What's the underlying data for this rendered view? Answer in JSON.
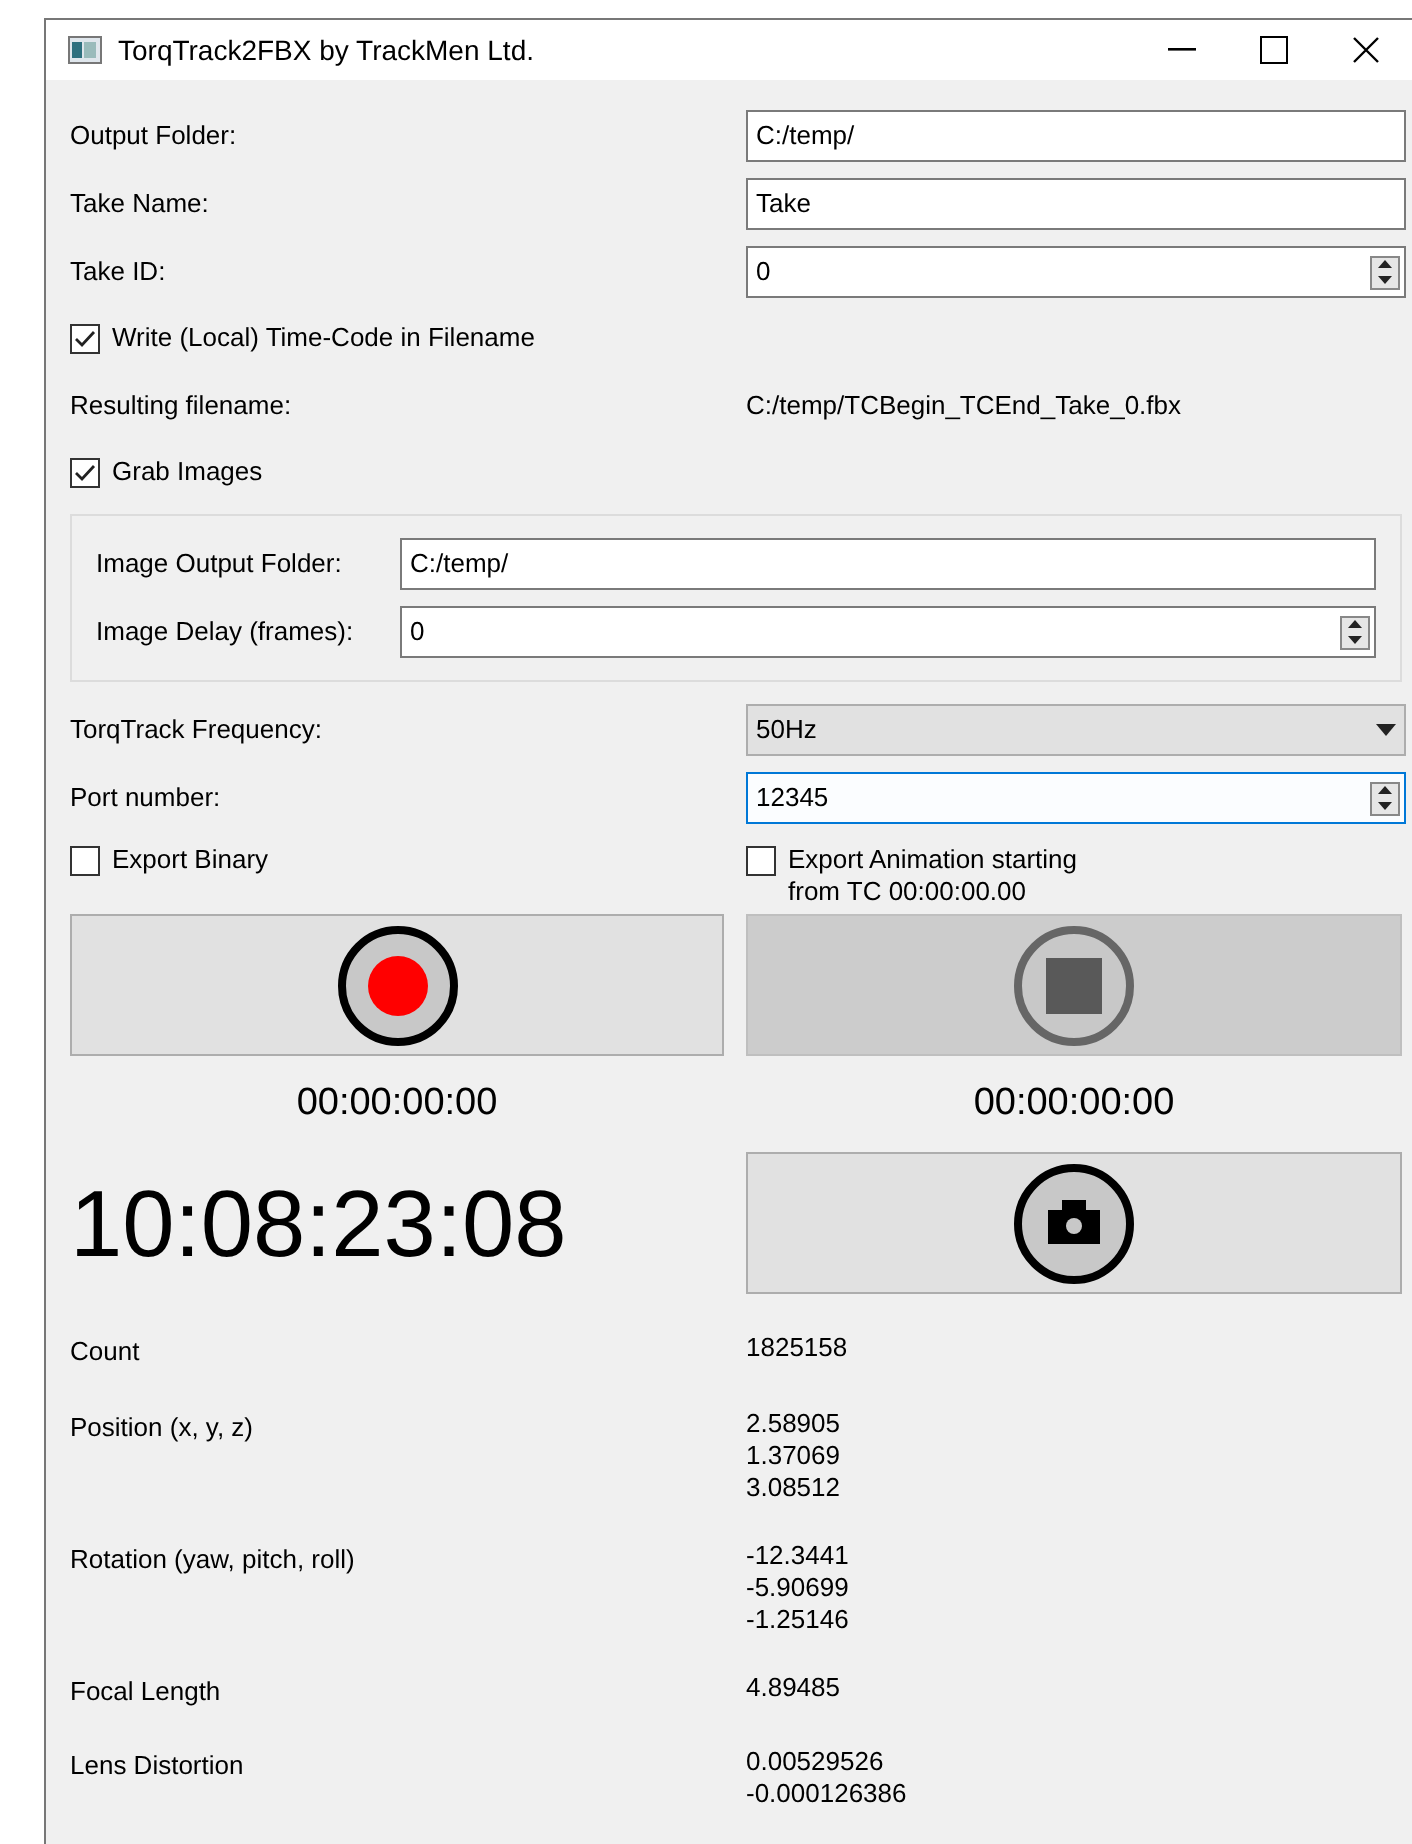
{
  "window": {
    "title": "TorqTrack2FBX by TrackMen Ltd."
  },
  "fields": [
    {
      "kind": "text",
      "label": "Output Folder:",
      "value": "C:/temp/"
    },
    {
      "kind": "text",
      "label": "Take Name:",
      "value": "Take"
    },
    {
      "kind": "spin",
      "label": "Take ID:",
      "value": "0"
    }
  ],
  "timecode_checkbox": {
    "label": "Write (Local) Time-Code in Filename",
    "checked": true
  },
  "resulting_filename": {
    "label": "Resulting filename:",
    "value": "C:/temp/TCBegin_TCEnd_Take_0.fbx"
  },
  "grab_checkbox": {
    "label": "Grab Images",
    "checked": true
  },
  "image_group": {
    "fields": [
      {
        "kind": "text",
        "label": "Image Output Folder:",
        "value": "C:/temp/"
      },
      {
        "kind": "spin",
        "label": "Image Delay (frames):",
        "value": "0"
      }
    ]
  },
  "settings": [
    {
      "kind": "combo",
      "label": "TorqTrack Frequency:",
      "value": "50Hz"
    },
    {
      "kind": "spin",
      "label": "Port number:",
      "value": "12345",
      "focused": true
    }
  ],
  "options": [
    {
      "label": "Export Binary",
      "checked": false
    },
    {
      "label": "Export Animation starting\nfrom TC 00:00:00.00",
      "checked": false
    }
  ],
  "record_button": {
    "disabled": false,
    "timecode": "00:00:00:00"
  },
  "stop_button": {
    "disabled": true,
    "timecode": "00:00:00:00"
  },
  "current_timecode": "10:08:23:08",
  "snapshot_button": {
    "disabled": false
  },
  "readouts": [
    {
      "label": "Count",
      "values": [
        "1825158"
      ]
    },
    {
      "label": "Position (x, y, z)",
      "values": [
        "2.58905",
        "1.37069",
        "3.08512"
      ]
    },
    {
      "label": "Rotation (yaw, pitch, roll)",
      "values": [
        "-12.3441",
        "-5.90699",
        "-1.25146"
      ]
    },
    {
      "label": "Focal Length",
      "values": [
        "4.89485"
      ]
    },
    {
      "label": "Lens Distortion",
      "values": [
        "0.00529526",
        "-0.000126386"
      ]
    }
  ]
}
